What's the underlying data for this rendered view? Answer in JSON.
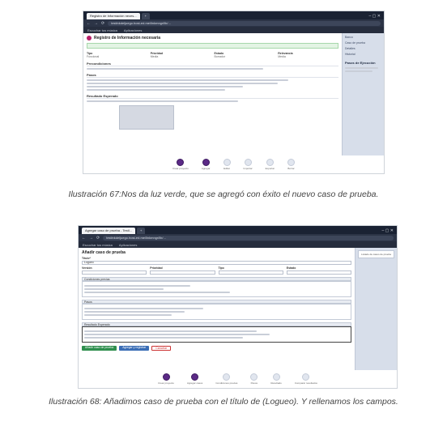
{
  "figure1": {
    "browser": {
      "tab_active": "Registro de Información neces...",
      "url": "testinkdeljuego.host-ed.me/linkmngr/lib/...",
      "bookmarks": [
        "Escuchar tus música",
        "Aplicaciones"
      ]
    },
    "app": {
      "page_title": "Registro de Información necesaria",
      "side_links": [
        "Banco",
        "Caso de prueba",
        "Detalles",
        "Historial"
      ],
      "side_head": "Pasos de Ejecución",
      "fields": [
        {
          "label": "Tipo",
          "value": "Funcional"
        },
        {
          "label": "Prioridad",
          "value": "Media"
        },
        {
          "label": "Estado",
          "value": "Borrador"
        },
        {
          "label": "Relevancia",
          "value": "Media"
        }
      ],
      "sections": [
        "Precondiciones",
        "Pasos",
        "Resultado Esperado"
      ]
    },
    "tools": [
      "Crear proyecto",
      "Agregar",
      "Editar",
      "Importar",
      "Exportar",
      "Borrar"
    ],
    "caption": "Ilustración 67:Nos da luz verde, que se agregó con éxito el nuevo caso de prueba."
  },
  "figure2": {
    "browser": {
      "tab_active": "Agregar caso de prueba - Testl...",
      "url": "testinkdeljuego.host-ed.me/linkmngr/lib/...",
      "bookmarks": [
        "Escuchar tus música",
        "Aplicaciones"
      ]
    },
    "app": {
      "page_title": "Añadir caso de prueba",
      "title_value": "Logueo",
      "row_labels": [
        "Versión",
        "Prioridad",
        "Tipo",
        "Estado"
      ],
      "sections": [
        "Condiciones previas",
        "Pasos",
        "Resultado Esperado"
      ],
      "buttons": [
        "Añadir caso de prueba",
        "Agregar y registrar",
        "Cancelar"
      ],
      "side_note": "Listado de casos de prueba"
    },
    "tools": [
      "Crear proyecto",
      "Agregar casos",
      "Condiciones previas",
      "Pasos",
      "Resultado",
      "Comparar resultados"
    ],
    "caption": "Ilustración 68: Añadimos caso de prueba con el título de (Logueo). Y rellenamos los campos."
  }
}
